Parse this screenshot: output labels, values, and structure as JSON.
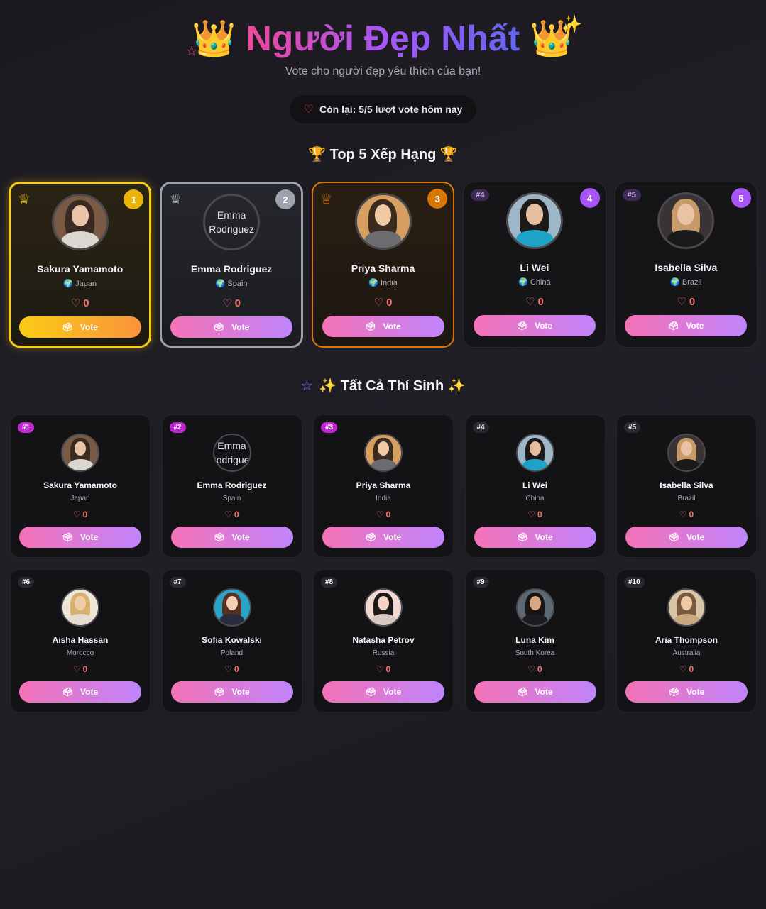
{
  "header": {
    "title": "Người Đẹp Nhất",
    "subtitle": "Vote cho người đẹp yêu thích của bạn!",
    "remaining": "Còn lại: 5/5 lượt vote hôm nay"
  },
  "top5": {
    "title": "🏆 Top 5 Xếp Hạng 🏆",
    "items": [
      {
        "rank": "1",
        "tag": "",
        "name": "Sakura Yamamoto",
        "country": "🌍 Japan",
        "votes": "0",
        "vote_label": "Vote",
        "alt": ""
      },
      {
        "rank": "2",
        "tag": "",
        "name": "Emma Rodriguez",
        "country": "🌍 Spain",
        "votes": "0",
        "vote_label": "Vote",
        "alt": "Emma Rodriguez"
      },
      {
        "rank": "3",
        "tag": "",
        "name": "Priya Sharma",
        "country": "🌍 India",
        "votes": "0",
        "vote_label": "Vote",
        "alt": ""
      },
      {
        "rank": "4",
        "tag": "#4",
        "name": "Li Wei",
        "country": "🌍 China",
        "votes": "0",
        "vote_label": "Vote",
        "alt": ""
      },
      {
        "rank": "5",
        "tag": "#5",
        "name": "Isabella Silva",
        "country": "🌍 Brazil",
        "votes": "0",
        "vote_label": "Vote",
        "alt": ""
      }
    ]
  },
  "all": {
    "title": "✨ Tất Cả Thí Sinh ✨",
    "items": [
      {
        "tag": "#1",
        "name": "Sakura Yamamoto",
        "country": "Japan",
        "votes": "0",
        "vote_label": "Vote"
      },
      {
        "tag": "#2",
        "name": "Emma Rodriguez",
        "country": "Spain",
        "votes": "0",
        "vote_label": "Vote",
        "alt": "Emma Rodriguez"
      },
      {
        "tag": "#3",
        "name": "Priya Sharma",
        "country": "India",
        "votes": "0",
        "vote_label": "Vote"
      },
      {
        "tag": "#4",
        "name": "Li Wei",
        "country": "China",
        "votes": "0",
        "vote_label": "Vote"
      },
      {
        "tag": "#5",
        "name": "Isabella Silva",
        "country": "Brazil",
        "votes": "0",
        "vote_label": "Vote"
      },
      {
        "tag": "#6",
        "name": "Aisha Hassan",
        "country": "Morocco",
        "votes": "0",
        "vote_label": "Vote"
      },
      {
        "tag": "#7",
        "name": "Sofia Kowalski",
        "country": "Poland",
        "votes": "0",
        "vote_label": "Vote"
      },
      {
        "tag": "#8",
        "name": "Natasha Petrov",
        "country": "Russia",
        "votes": "0",
        "vote_label": "Vote"
      },
      {
        "tag": "#9",
        "name": "Luna Kim",
        "country": "South Korea",
        "votes": "0",
        "vote_label": "Vote"
      },
      {
        "tag": "#10",
        "name": "Aria Thompson",
        "country": "Australia",
        "votes": "0",
        "vote_label": "Vote"
      }
    ]
  },
  "colors": {
    "gold": "#facc15",
    "silver": "#9ca3af",
    "bronze": "#d97706",
    "accent_pink": "#f472b6",
    "accent_purple": "#c084fc",
    "heart": "#f87171"
  },
  "icons": {
    "crown": "crown-icon",
    "heart": "heart-icon",
    "vote": "ballot-icon",
    "globe": "globe-icon",
    "sparkle": "sparkle-icon",
    "star": "star-icon"
  }
}
